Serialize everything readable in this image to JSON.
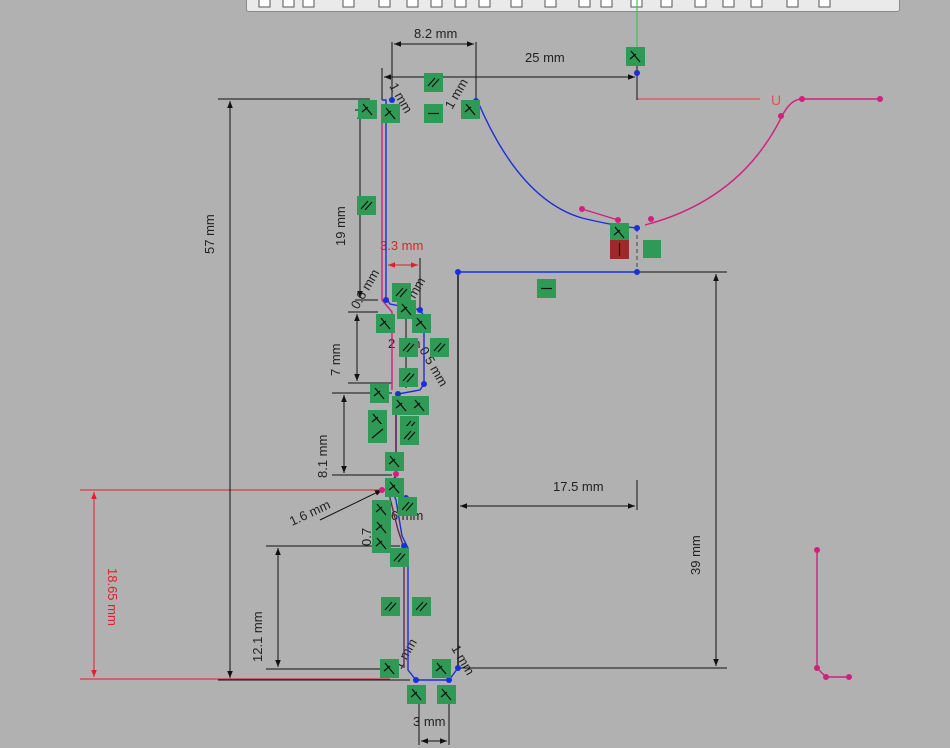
{
  "toolbar": {
    "tools": [
      "sketch-tool",
      "plane-tool",
      "box-tool",
      "dimension-tool",
      "constraint-tool",
      "rectangle-tool",
      "line-tool",
      "trim-tool",
      "pattern-tool",
      "mirror-tool",
      "construction-tool",
      "relation-tool",
      "fillet-tool",
      "offset-tool",
      "convert-tool",
      "measure-tool",
      "repair-tool",
      "move-tool",
      "show-relations-tool",
      "settings-tool"
    ]
  },
  "dimensions": {
    "d_8_2": "8.2 mm",
    "d_25": "25 mm",
    "d_1_top_left": "1 mm",
    "d_1_top_right": "1 mm",
    "d_57": "57 mm",
    "d_19": "19 mm",
    "d_3_3": "3.3 mm",
    "d_0_6": "0.6 mm",
    "d_0_7": "0.7 mm",
    "d_2": "2 mm",
    "d_0_5": "0.5 mm",
    "d_7": "7 mm",
    "d_0_4": "0.4 mm",
    "d_8_1": "8.1 mm",
    "d_1_6": "1.6 mm",
    "d_0_6b": "0.6 mm",
    "d_0_7b": "0.7",
    "d_18_65": "18.65 mm",
    "d_12_1": "12.1 mm",
    "d_1_bottom_left": "1 mm",
    "d_1_bottom_right": "1 mm",
    "d_3": "3 mm",
    "d_17_5": "17.5 mm",
    "d_39": "39 mm"
  },
  "labels": {
    "u_marker": "U"
  },
  "colors": {
    "background": "#b1b1b1",
    "dimension": "#222222",
    "driven_dimension": "#e0202a",
    "geometry_blue": "#1a2fd6",
    "geometry_pink": "#d3207c",
    "constraint_green": "#2f9a55",
    "constraint_selected": "#9c2a2a",
    "origin_axis_red": "#e05050"
  }
}
